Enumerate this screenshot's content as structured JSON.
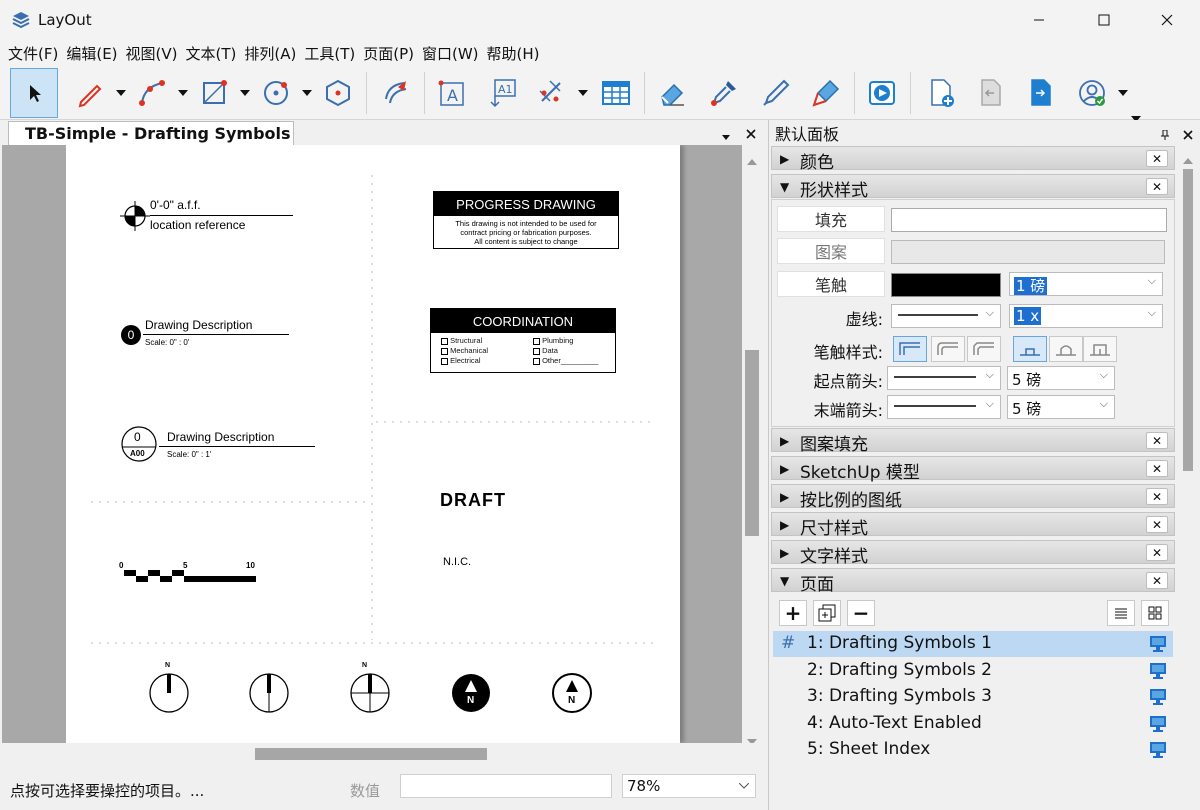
{
  "app": {
    "title": "LayOut"
  },
  "menu": [
    "文件(F)",
    "编辑(E)",
    "视图(V)",
    "文本(T)",
    "排列(A)",
    "工具(T)",
    "页面(P)",
    "窗口(W)",
    "帮助(H)"
  ],
  "toolbar": {
    "icons": [
      "select-arrow-icon",
      "pencil-icon",
      "arc-icon",
      "rectangle-icon",
      "circle-icon",
      "polygon-icon",
      "offset-icon",
      "text-icon",
      "label-icon",
      "dimension-icon",
      "table-icon",
      "eraser-icon",
      "sampler-icon",
      "style-icon",
      "split-icon",
      "presentation-icon",
      "add-page-icon",
      "previous-page-icon",
      "next-page-icon",
      "account-icon"
    ]
  },
  "document": {
    "tab_title": "TB-Simple - Drafting Symbols 1"
  },
  "paper": {
    "elevation_text1": "0'-0\" a.f.f.",
    "elevation_text2": "location reference",
    "desc1_num": "0",
    "desc1_title": "Drawing Description",
    "desc1_scale": "Scale:  0\" : 0'",
    "desc2_num": "0",
    "desc2_sheet": "A00",
    "desc2_title": "Drawing Description",
    "desc2_scale": "Scale:  0\" : 1'",
    "scalebar_0": "0",
    "scalebar_5": "5",
    "scalebar_10": "10",
    "progress_title": "PROGRESS DRAWING",
    "progress_body1": "This drawing is not intended to be used for",
    "progress_body2": "contract pricing or fabrication purposes.",
    "progress_body3": "All content is subject to change",
    "coord_title": "COORDINATION",
    "coord_items": [
      "Structural",
      "Mechanical",
      "Electrical",
      "Plumbing",
      "Data",
      "Other"
    ],
    "draft_text": "DRAFT",
    "nic_text": "N.I.C.",
    "north_label": "N"
  },
  "status": {
    "hint": "点按可选择要操控的项目。...",
    "value_label": "数值",
    "zoom": "78%"
  },
  "panel": {
    "title": "默认面板",
    "sections": {
      "color": "颜色",
      "shape_style": "形状样式",
      "pattern_fill": "图案填充",
      "sketchup": "SketchUp 模型",
      "scaled": "按比例的图纸",
      "dimension": "尺寸样式",
      "text": "文字样式",
      "pages": "页面"
    },
    "shape": {
      "fill_label": "填充",
      "pattern_label": "图案",
      "stroke_label": "笔触",
      "stroke_weight": "1 磅",
      "dash_label": "虚线:",
      "dash_scale": "1 x",
      "stroke_style_label": "笔触样式:",
      "start_arrow_label": "起点箭头:",
      "start_arrow_size": "5 磅",
      "end_arrow_label": "末端箭头:",
      "end_arrow_size": "5 磅"
    },
    "pages": [
      {
        "num": "1:",
        "name": "Drafting Symbols 1"
      },
      {
        "num": "2:",
        "name": "Drafting Symbols 2"
      },
      {
        "num": "3:",
        "name": "Drafting Symbols 3"
      },
      {
        "num": "4:",
        "name": "Auto-Text Enabled"
      },
      {
        "num": "5:",
        "name": "Sheet Index"
      }
    ],
    "current_page_marker": "#"
  }
}
